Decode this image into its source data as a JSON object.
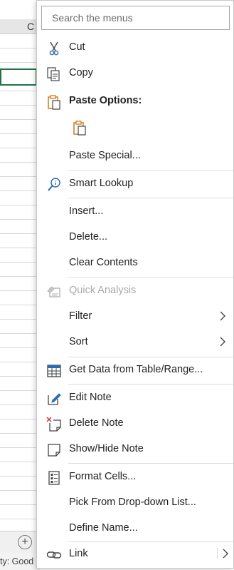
{
  "sheet": {
    "column_letter": "C",
    "status_text": "ty: Good",
    "add_sheet_symbol": "+"
  },
  "menu": {
    "search_placeholder": "Search the menus",
    "items": {
      "cut": "Cut",
      "copy": "Copy",
      "paste_options": "Paste Options:",
      "paste_special": "Paste Special...",
      "smart_lookup": "Smart Lookup",
      "insert": "Insert...",
      "delete": "Delete...",
      "clear_contents": "Clear Contents",
      "quick_analysis": "Quick Analysis",
      "filter": "Filter",
      "sort": "Sort",
      "get_data": "Get Data from Table/Range...",
      "edit_note": "Edit Note",
      "delete_note": "Delete Note",
      "show_hide_note": "Show/Hide Note",
      "format_cells": "Format Cells...",
      "pick_list": "Pick From Drop-down List...",
      "define_name": "Define Name...",
      "link": "Link"
    }
  },
  "colors": {
    "accent_green": "#217346",
    "icon_orange": "#d47a1c",
    "icon_blue": "#2b6cb0",
    "icon_red": "#d13438"
  }
}
